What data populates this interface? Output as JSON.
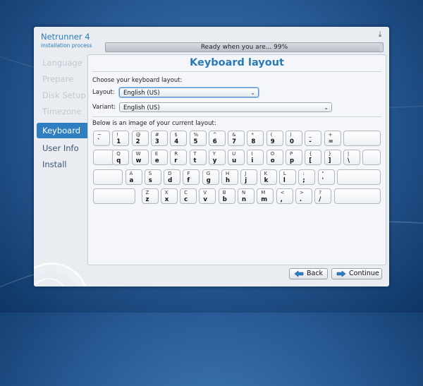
{
  "app": {
    "title": "Netrunner 4",
    "subtitle": "installation process"
  },
  "progress": {
    "text": "Ready when you are... 99%",
    "fraction": 0.99
  },
  "sidebar": {
    "items": [
      {
        "label": "Language",
        "state": "done"
      },
      {
        "label": "Prepare",
        "state": "done"
      },
      {
        "label": "Disk Setup",
        "state": "done"
      },
      {
        "label": "Timezone",
        "state": "done"
      },
      {
        "label": "Keyboard",
        "state": "active"
      },
      {
        "label": "User Info",
        "state": "future"
      },
      {
        "label": "Install",
        "state": "future"
      }
    ]
  },
  "page": {
    "title": "Keyboard layout",
    "choose_label": "Choose your keyboard layout:",
    "layout_label": "Layout:",
    "layout_value": "English (US)",
    "variant_label": "Variant:",
    "variant_value": "English (US)",
    "image_label": "Below is an image of your current layout:"
  },
  "keyboard": {
    "rows": [
      [
        {
          "u": "~",
          "l": "`"
        },
        {
          "u": "!",
          "l": "1"
        },
        {
          "u": "@",
          "l": "2"
        },
        {
          "u": "#",
          "l": "3"
        },
        {
          "u": "$",
          "l": "4"
        },
        {
          "u": "%",
          "l": "5"
        },
        {
          "u": "^",
          "l": "6"
        },
        {
          "u": "&",
          "l": "7"
        },
        {
          "u": "*",
          "l": "8"
        },
        {
          "u": "(",
          "l": "9"
        },
        {
          "u": ")",
          "l": "0"
        },
        {
          "u": "_",
          "l": "-"
        },
        {
          "u": "+",
          "l": "="
        }
      ],
      [
        {
          "u": "Q",
          "l": "q"
        },
        {
          "u": "W",
          "l": "w"
        },
        {
          "u": "E",
          "l": "e"
        },
        {
          "u": "R",
          "l": "r"
        },
        {
          "u": "T",
          "l": "t"
        },
        {
          "u": "Y",
          "l": "y"
        },
        {
          "u": "U",
          "l": "u"
        },
        {
          "u": "I",
          "l": "i"
        },
        {
          "u": "O",
          "l": "o"
        },
        {
          "u": "P",
          "l": "p"
        },
        {
          "u": "{",
          "l": "["
        },
        {
          "u": "}",
          "l": "]"
        },
        {
          "u": "|",
          "l": "\\"
        }
      ],
      [
        {
          "u": "A",
          "l": "a"
        },
        {
          "u": "S",
          "l": "s"
        },
        {
          "u": "D",
          "l": "d"
        },
        {
          "u": "F",
          "l": "f"
        },
        {
          "u": "G",
          "l": "g"
        },
        {
          "u": "H",
          "l": "h"
        },
        {
          "u": "J",
          "l": "j"
        },
        {
          "u": "K",
          "l": "k"
        },
        {
          "u": "L",
          "l": "l"
        },
        {
          "u": ":",
          "l": ";"
        },
        {
          "u": "\"",
          "l": "'"
        }
      ],
      [
        {
          "u": "Z",
          "l": "z"
        },
        {
          "u": "X",
          "l": "x"
        },
        {
          "u": "C",
          "l": "c"
        },
        {
          "u": "V",
          "l": "v"
        },
        {
          "u": "B",
          "l": "b"
        },
        {
          "u": "N",
          "l": "n"
        },
        {
          "u": "M",
          "l": "m"
        },
        {
          "u": "<",
          "l": ","
        },
        {
          "u": ">",
          "l": "."
        },
        {
          "u": "?",
          "l": "/"
        }
      ]
    ]
  },
  "buttons": {
    "back": "Back",
    "continue": "Continue"
  },
  "colors": {
    "accent": "#2f7ec0",
    "title": "#2a7ab8"
  },
  "icons": {
    "back": "arrow-left-icon",
    "continue": "arrow-right-icon",
    "minimize": "minimize-icon"
  }
}
